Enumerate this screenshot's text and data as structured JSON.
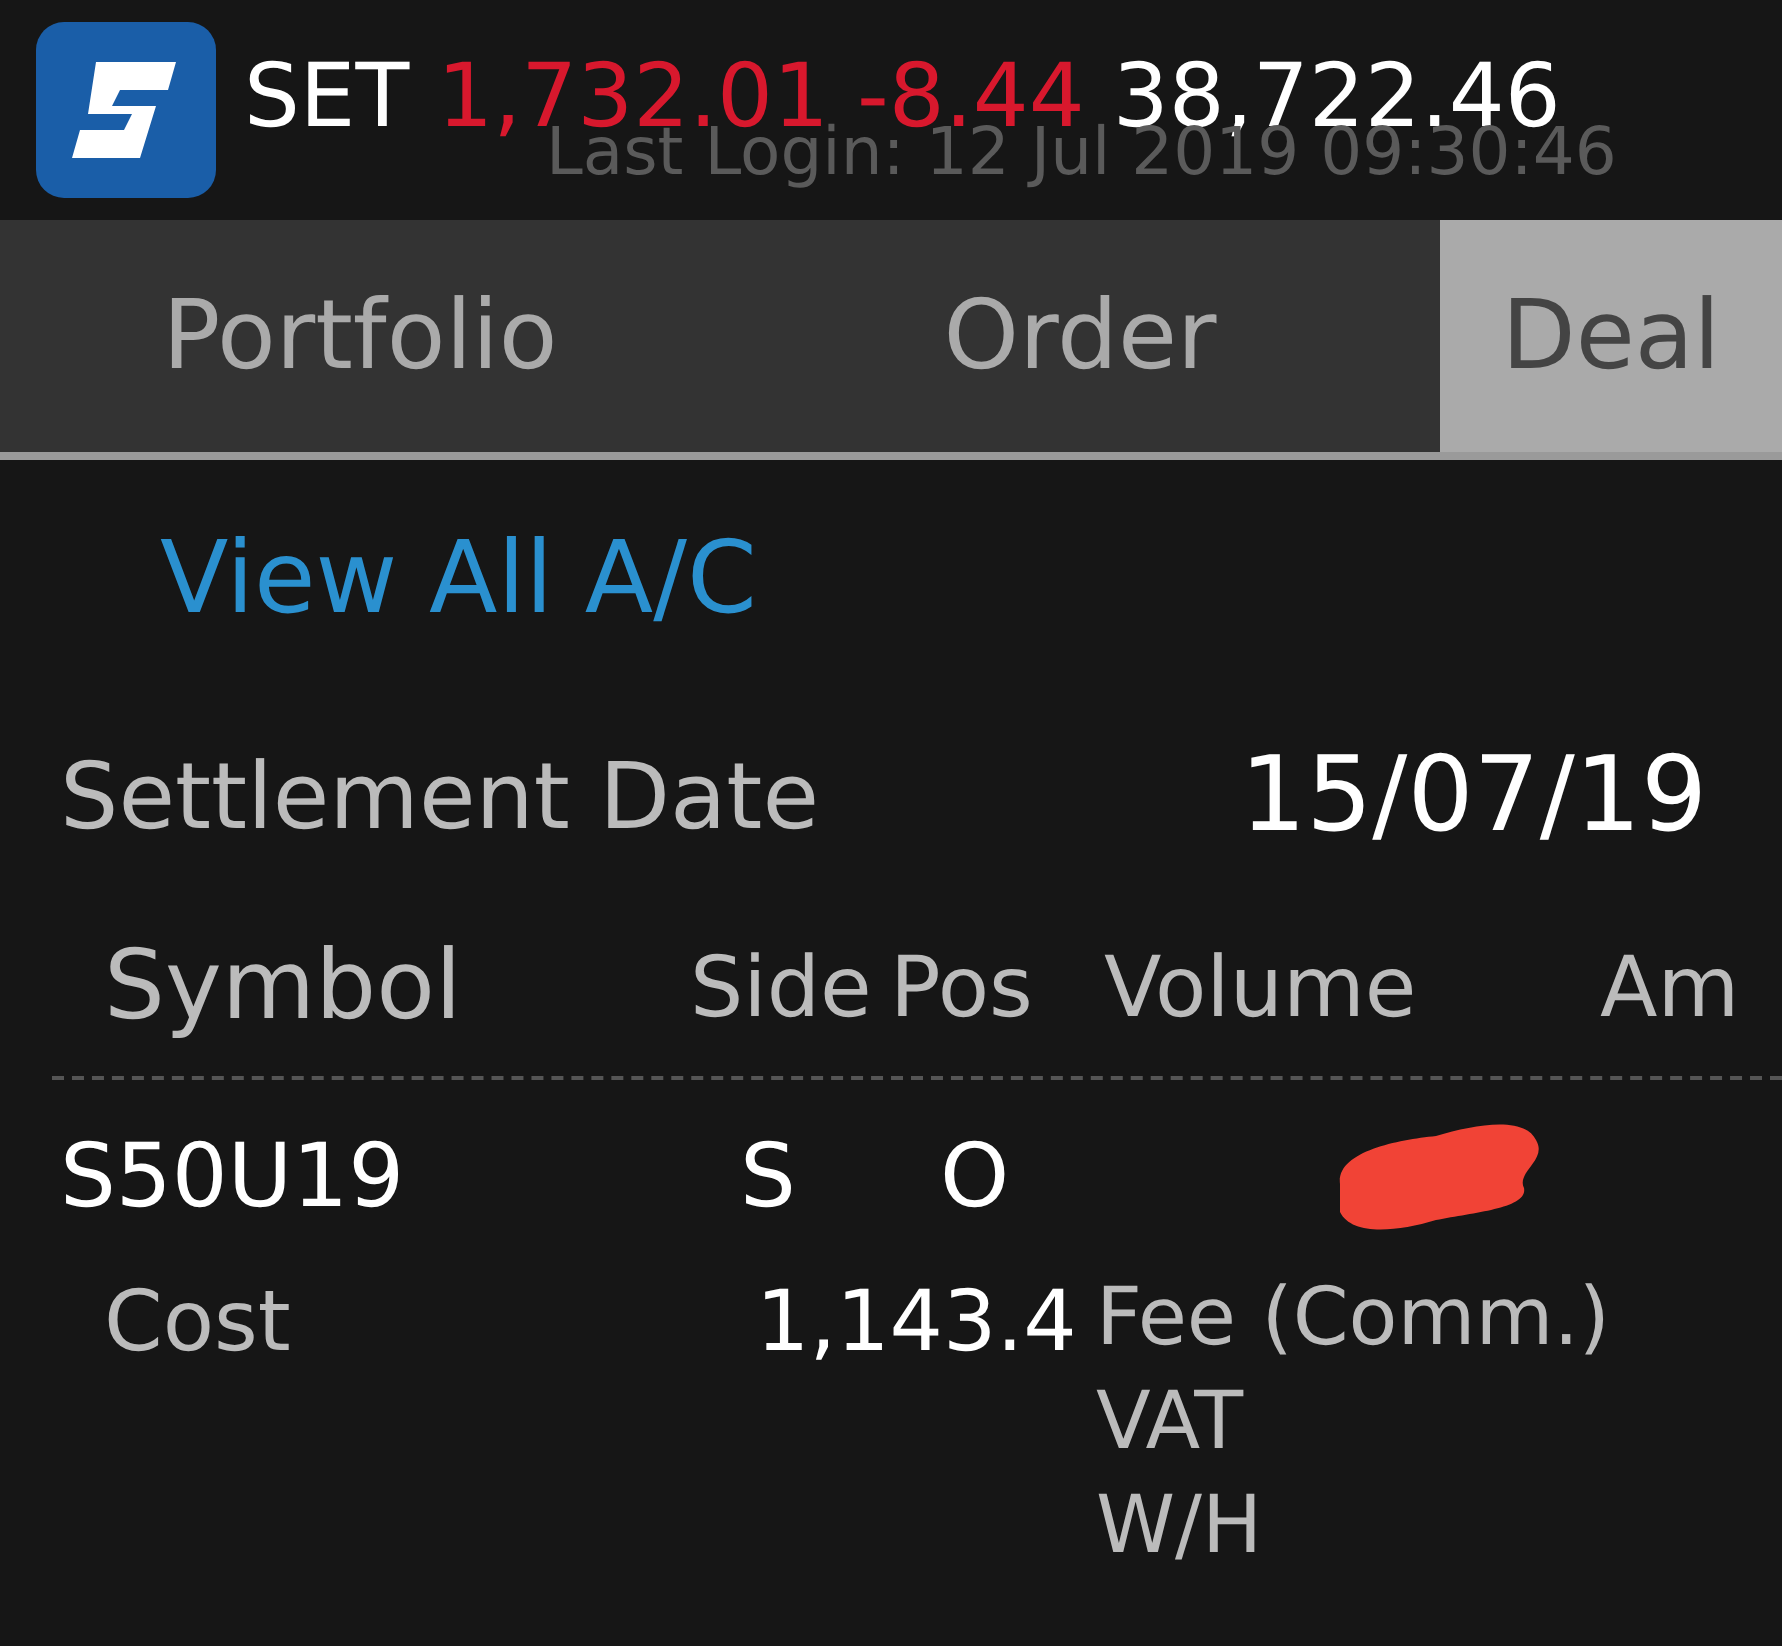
{
  "header": {
    "index_name": "SET",
    "index_value": "1,732.01",
    "index_change": "-8.44",
    "value_traded": "38,722.46",
    "last_login": "Last Login: 12 Jul 2019 09:30:46"
  },
  "tabs": [
    {
      "label": "Portfolio",
      "selected": false
    },
    {
      "label": "Order",
      "selected": false
    },
    {
      "label": "Deal",
      "selected": true
    }
  ],
  "view_all_link": "View All A/C",
  "settlement": {
    "label": "Settlement Date",
    "value": "15/07/19"
  },
  "columns": [
    "Symbol",
    "Side",
    "Pos",
    "Volume",
    "Am"
  ],
  "deals": [
    {
      "symbol": "S50U19",
      "side": "S",
      "pos": "O",
      "volume_redacted": true,
      "cost_label": "Cost",
      "cost": "1,143.4",
      "fee_labels": [
        "Fee (Comm.)",
        "VAT",
        "W/H"
      ]
    }
  ]
}
